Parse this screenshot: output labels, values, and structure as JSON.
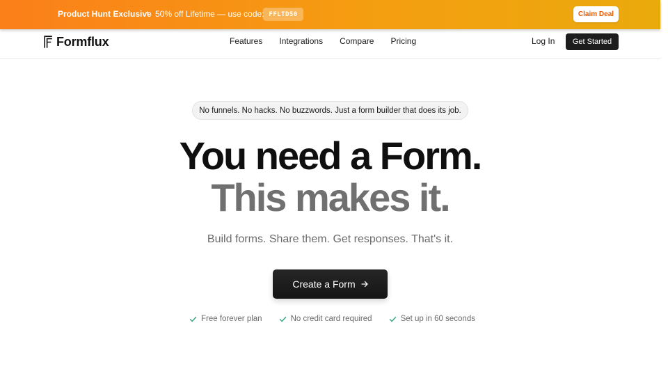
{
  "promo": {
    "title": "Product Hunt Exclusive",
    "separator": "•",
    "offer": "50% off Lifetime — use code:",
    "code": "FFLTD50",
    "cta_label": "Claim Deal"
  },
  "nav": {
    "brand": "Formflux",
    "links": [
      {
        "label": "Features"
      },
      {
        "label": "Integrations"
      },
      {
        "label": "Compare"
      },
      {
        "label": "Pricing"
      }
    ],
    "login_label": "Log In",
    "get_started_label": "Get Started"
  },
  "hero": {
    "pill": "No funnels. No hacks. No buzzwords. Just a form builder that does its job.",
    "headline_line1": "You need a Form.",
    "headline_line2": "This makes it.",
    "subheadline": "Build forms. Share them. Get responses. That's it.",
    "cta_label": "Create a Form",
    "features": [
      {
        "label": "Free forever plan",
        "icon": "check-icon"
      },
      {
        "label": "No credit card required",
        "icon": "check-icon"
      },
      {
        "label": "Set up in 60 seconds",
        "icon": "check-icon"
      }
    ]
  },
  "colors": {
    "promo_gradient_start": "#fb7f1a",
    "promo_gradient_end": "#eaaa0c",
    "claim_text": "#e65c06",
    "dark_button": "#1d1d1d",
    "headline_dark": "#0f0f0f",
    "headline_gray": "#707070",
    "check_green": "#34a37a"
  }
}
